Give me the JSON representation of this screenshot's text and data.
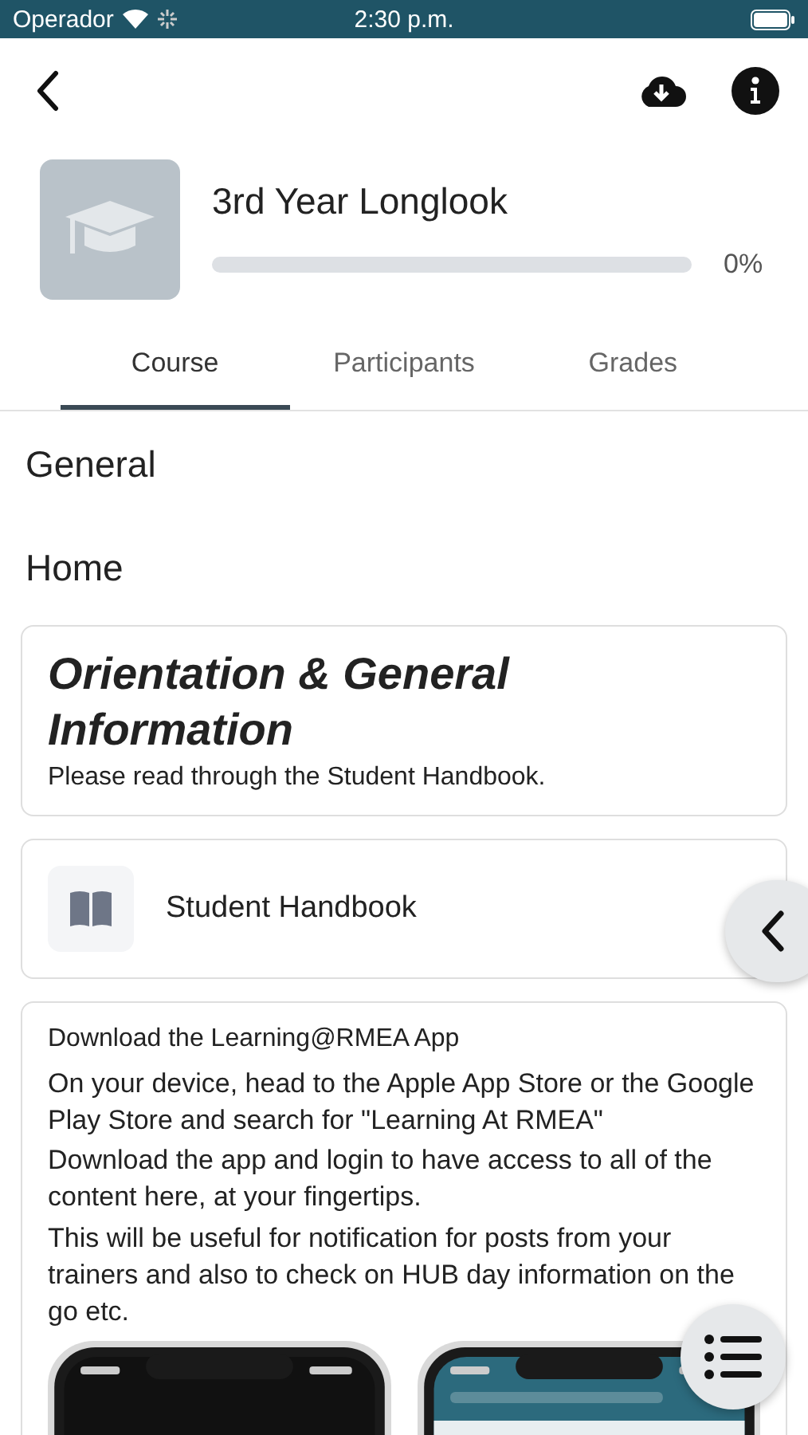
{
  "status_bar": {
    "carrier": "Operador",
    "time": "2:30 p.m."
  },
  "course": {
    "title": "3rd Year Longlook",
    "level": 0,
    "reading": "0%"
  },
  "tabs": [
    {
      "label": "Course",
      "selected": true
    },
    {
      "label": "Participants",
      "selected": false
    },
    {
      "label": "Grades",
      "selected": false
    }
  ],
  "sections": [
    "General",
    "Home"
  ],
  "cards": [
    {
      "kind": "summary",
      "title": "Orientation & General Information",
      "text": "Please read through the Student Handbook."
    },
    {
      "kind": "module",
      "label": "Student Handbook"
    },
    {
      "kind": "text",
      "paragraphs": [
        "Download the Learning@RMEA App",
        "On your device, head to the Apple App Store or the Google Play Store and search for \"Learning At RMEA\"",
        "Download the app and login to have access to all of the content here, at your fingertips.",
        "This will be useful for notification for posts from your trainers and also to check on HUB day information on the go etc."
      ]
    }
  ]
}
